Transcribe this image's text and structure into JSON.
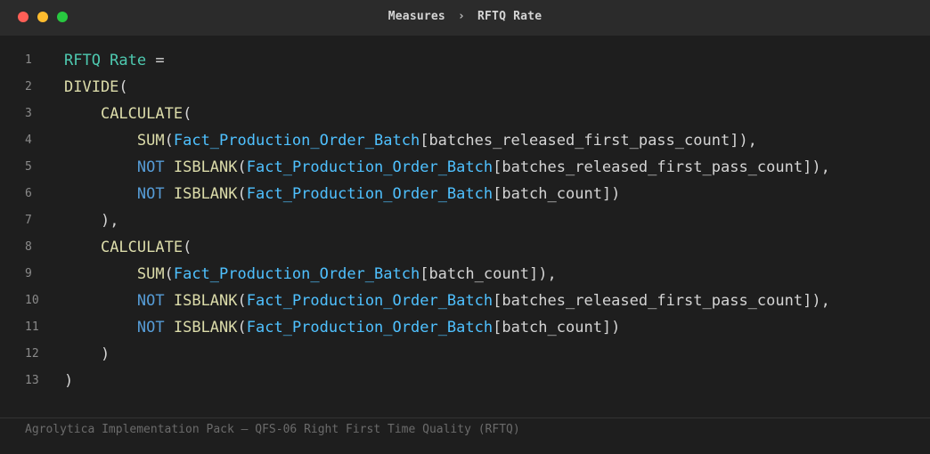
{
  "window": {
    "controls": {
      "close_color": "#ff5f57",
      "minimize_color": "#febc2e",
      "maximize_color": "#28c840"
    },
    "breadcrumb": {
      "parent": "Measures",
      "separator": "›",
      "current": "RFTQ Rate"
    }
  },
  "editor": {
    "lines": [
      {
        "n": "1",
        "tokens": [
          {
            "t": "RFTQ Rate",
            "c": "measure"
          },
          {
            "t": " =",
            "c": "op"
          }
        ]
      },
      {
        "n": "2",
        "tokens": [
          {
            "t": "DIVIDE",
            "c": "func"
          },
          {
            "t": "(",
            "c": "punc"
          }
        ]
      },
      {
        "n": "3",
        "tokens": [
          {
            "t": "    ",
            "c": "punc"
          },
          {
            "t": "CALCULATE",
            "c": "func"
          },
          {
            "t": "(",
            "c": "punc"
          }
        ]
      },
      {
        "n": "4",
        "tokens": [
          {
            "t": "        ",
            "c": "punc"
          },
          {
            "t": "SUM",
            "c": "func"
          },
          {
            "t": "(",
            "c": "punc"
          },
          {
            "t": "Fact_Production_Order_Batch",
            "c": "table"
          },
          {
            "t": "[batches_released_first_pass_count]",
            "c": "col"
          },
          {
            "t": "),",
            "c": "punc"
          }
        ]
      },
      {
        "n": "5",
        "tokens": [
          {
            "t": "        ",
            "c": "punc"
          },
          {
            "t": "NOT",
            "c": "kw"
          },
          {
            "t": " ",
            "c": "punc"
          },
          {
            "t": "ISBLANK",
            "c": "func"
          },
          {
            "t": "(",
            "c": "punc"
          },
          {
            "t": "Fact_Production_Order_Batch",
            "c": "table"
          },
          {
            "t": "[batches_released_first_pass_count]",
            "c": "col"
          },
          {
            "t": "),",
            "c": "punc"
          }
        ]
      },
      {
        "n": "6",
        "tokens": [
          {
            "t": "        ",
            "c": "punc"
          },
          {
            "t": "NOT",
            "c": "kw"
          },
          {
            "t": " ",
            "c": "punc"
          },
          {
            "t": "ISBLANK",
            "c": "func"
          },
          {
            "t": "(",
            "c": "punc"
          },
          {
            "t": "Fact_Production_Order_Batch",
            "c": "table"
          },
          {
            "t": "[batch_count]",
            "c": "col"
          },
          {
            "t": ")",
            "c": "punc"
          }
        ]
      },
      {
        "n": "7",
        "tokens": [
          {
            "t": "    ",
            "c": "punc"
          },
          {
            "t": "),",
            "c": "punc"
          }
        ]
      },
      {
        "n": "8",
        "tokens": [
          {
            "t": "    ",
            "c": "punc"
          },
          {
            "t": "CALCULATE",
            "c": "func"
          },
          {
            "t": "(",
            "c": "punc"
          }
        ]
      },
      {
        "n": "9",
        "tokens": [
          {
            "t": "        ",
            "c": "punc"
          },
          {
            "t": "SUM",
            "c": "func"
          },
          {
            "t": "(",
            "c": "punc"
          },
          {
            "t": "Fact_Production_Order_Batch",
            "c": "table"
          },
          {
            "t": "[batch_count]",
            "c": "col"
          },
          {
            "t": "),",
            "c": "punc"
          }
        ]
      },
      {
        "n": "10",
        "tokens": [
          {
            "t": "        ",
            "c": "punc"
          },
          {
            "t": "NOT",
            "c": "kw"
          },
          {
            "t": " ",
            "c": "punc"
          },
          {
            "t": "ISBLANK",
            "c": "func"
          },
          {
            "t": "(",
            "c": "punc"
          },
          {
            "t": "Fact_Production_Order_Batch",
            "c": "table"
          },
          {
            "t": "[batches_released_first_pass_count]",
            "c": "col"
          },
          {
            "t": "),",
            "c": "punc"
          }
        ]
      },
      {
        "n": "11",
        "tokens": [
          {
            "t": "        ",
            "c": "punc"
          },
          {
            "t": "NOT",
            "c": "kw"
          },
          {
            "t": " ",
            "c": "punc"
          },
          {
            "t": "ISBLANK",
            "c": "func"
          },
          {
            "t": "(",
            "c": "punc"
          },
          {
            "t": "Fact_Production_Order_Batch",
            "c": "table"
          },
          {
            "t": "[batch_count]",
            "c": "col"
          },
          {
            "t": ")",
            "c": "punc"
          }
        ]
      },
      {
        "n": "12",
        "tokens": [
          {
            "t": "    ",
            "c": "punc"
          },
          {
            "t": ")",
            "c": "punc"
          }
        ]
      },
      {
        "n": "13",
        "tokens": [
          {
            "t": ")",
            "c": "punc"
          }
        ]
      }
    ]
  },
  "footer": {
    "text": "Agrolytica Implementation Pack — QFS-06 Right First Time Quality (RFTQ)"
  },
  "colors": {
    "background": "#1e1e1e",
    "titlebar": "#2b2b2b",
    "measure_name": "#4ec9b0",
    "function": "#dcdcaa",
    "keyword": "#569cd6",
    "table": "#4fc1ff",
    "text": "#d4d4d4"
  }
}
